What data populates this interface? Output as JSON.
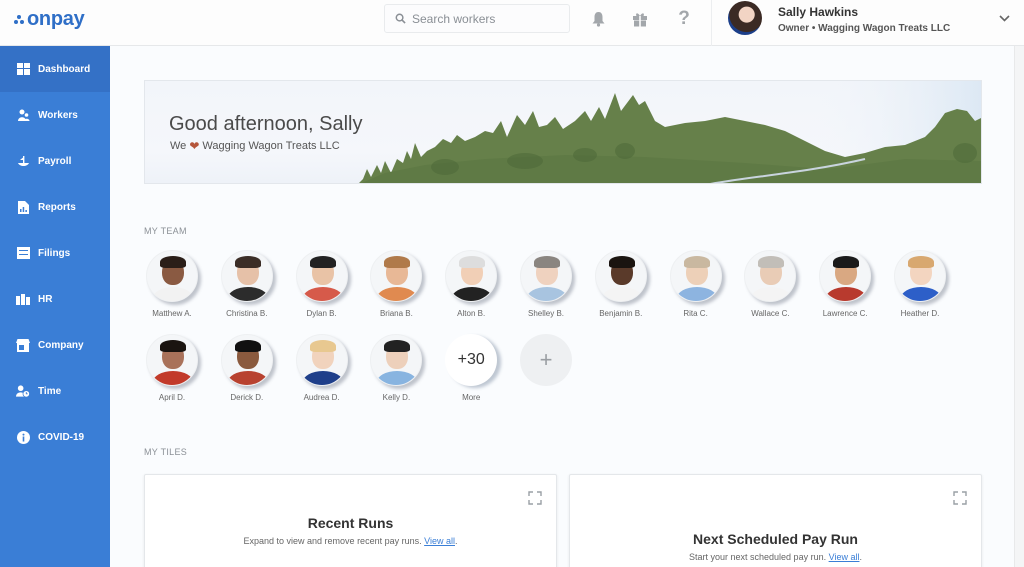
{
  "app": {
    "logo_text": "onpay",
    "brand_color": "#3a7ed6"
  },
  "header": {
    "search_placeholder": "Search workers",
    "icons": [
      "bell-icon",
      "gift-icon",
      "help-icon"
    ],
    "user": {
      "name": "Sally Hawkins",
      "role": "Owner • Wagging Wagon Treats LLC"
    }
  },
  "sidebar": {
    "items": [
      {
        "label": "Dashboard",
        "icon": "dashboard-icon",
        "active": true
      },
      {
        "label": "Workers",
        "icon": "workers-icon"
      },
      {
        "label": "Payroll",
        "icon": "payroll-icon"
      },
      {
        "label": "Reports",
        "icon": "reports-icon"
      },
      {
        "label": "Filings",
        "icon": "filings-icon"
      },
      {
        "label": "HR",
        "icon": "hr-icon"
      },
      {
        "label": "Company",
        "icon": "company-icon"
      },
      {
        "label": "Time",
        "icon": "time-icon"
      },
      {
        "label": "COVID-19",
        "icon": "info-icon"
      }
    ]
  },
  "hero": {
    "greeting": "Good afternoon, Sally",
    "sub_prefix": "We",
    "sub_company": "Wagging Wagon Treats LLC"
  },
  "team": {
    "label": "MY TEAM",
    "members": [
      {
        "name": "Matthew A."
      },
      {
        "name": "Christina B."
      },
      {
        "name": "Dylan B."
      },
      {
        "name": "Briana B."
      },
      {
        "name": "Alton B."
      },
      {
        "name": "Shelley B."
      },
      {
        "name": "Benjamin B."
      },
      {
        "name": "Rita C."
      },
      {
        "name": "Wallace C."
      },
      {
        "name": "Lawrence C."
      },
      {
        "name": "Heather D."
      },
      {
        "name": "April D."
      },
      {
        "name": "Derick D."
      },
      {
        "name": "Audrea D."
      },
      {
        "name": "Kelly D."
      }
    ],
    "more_count": "+30",
    "more_label": "More",
    "add_label": "+"
  },
  "tiles": {
    "label": "MY TILES",
    "items": [
      {
        "title": "Recent Runs",
        "desc": "Expand to view and remove recent pay runs.",
        "link": "View all"
      },
      {
        "title": "Next Scheduled Pay Run",
        "desc": "Start your next scheduled pay run.",
        "link": "View all"
      }
    ]
  }
}
